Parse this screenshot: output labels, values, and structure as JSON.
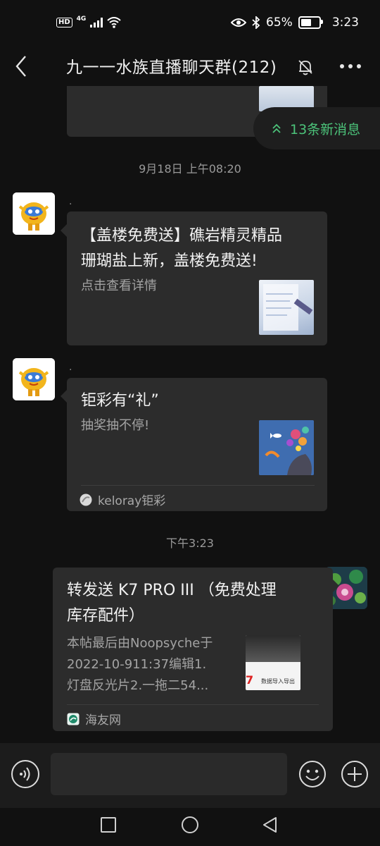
{
  "status_bar": {
    "network": "4G",
    "hd_label": "HD",
    "battery_pct": "65%",
    "time": "3:23"
  },
  "header": {
    "title": "九一一水族直播聊天群(212)"
  },
  "new_messages_pill": {
    "label": "13条新消息"
  },
  "messages": {
    "ts1": "9月18日 上午08:20",
    "m1": {
      "sender": ".",
      "title_line1": "【盖楼免费送】礁岩精灵精品",
      "title_line2": "珊瑚盐上新，盖楼免费送!",
      "desc": "点击查看详情"
    },
    "m2": {
      "sender": ".",
      "title": "钜彩有“礼”",
      "desc": "抽奖抽不停!",
      "source": "keloray钜彩"
    },
    "ts2": "下午3:23",
    "m3": {
      "title_line1": "转发送 K7 PRO III （免费处理",
      "title_line2": "库存配件）",
      "desc_line1": "本帖最后由Noopsyche于",
      "desc_line2": "2022-10-911:37编辑1.",
      "desc_line3": "灯盘反光片2.一拖二54...",
      "thumb_text": "数据导入导出",
      "thumb_mark": "7",
      "source": "海友网"
    }
  },
  "colors": {
    "background": "#111111",
    "bubble": "#2c2c2c",
    "accent_green": "#4cc37a"
  }
}
